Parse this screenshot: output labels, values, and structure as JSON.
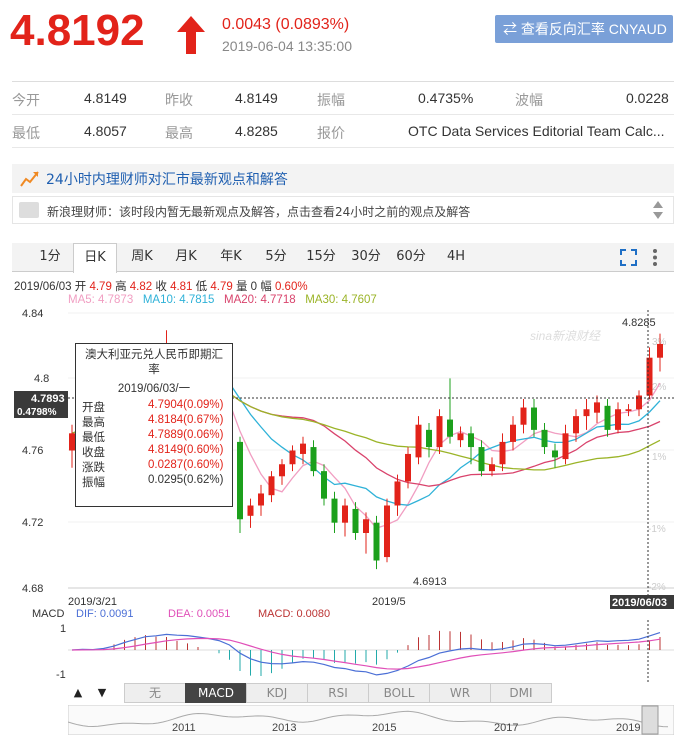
{
  "header": {
    "price": "4.8192",
    "change": "0.0043 (0.0893%)",
    "time": "2019-06-04 13:35:00",
    "reverse_button": "⇄ 查看反向汇率 CNYAUD"
  },
  "stats": {
    "row1": {
      "open_label": "今开",
      "open": "4.8149",
      "prev_close_label": "昨收",
      "prev_close": "4.8149",
      "amplitude_label": "振幅",
      "amplitude": "0.4735%",
      "wave_label": "波幅",
      "wave": "0.0228"
    },
    "row2": {
      "low_label": "最低",
      "low": "4.8057",
      "high_label": "最高",
      "high": "4.8285",
      "quote_label": "报价",
      "quote": "OTC Data Services Editorial Team Calc..."
    }
  },
  "advisor": {
    "title": "24小时内理财师对汇市最新观点和解答",
    "message": "新浪理财师：该时段内暂无最新观点及解答，点击查看24小时之前的观点及解答"
  },
  "tabs": [
    "1分",
    "日K",
    "周K",
    "月K",
    "年K",
    "5分",
    "15分",
    "30分",
    "60分",
    "4H"
  ],
  "active_tab": "日K",
  "legend": {
    "date": "2019/06/03",
    "open_label": "开",
    "open": "4.79",
    "high_label": "高",
    "high": "4.82",
    "close_label": "收",
    "close": "4.81",
    "low_label": "低",
    "low": "4.79",
    "volume_label": "量",
    "volume": "0",
    "amp_label": "幅",
    "amp": "0.60%"
  },
  "ma_legend": [
    {
      "text": "MA5: 4.7873",
      "color": "#f19ec2"
    },
    {
      "text": "MA10: 4.7815",
      "color": "#2fb2d8"
    },
    {
      "text": "MA20: 4.7718",
      "color": "#d9436c"
    },
    {
      "text": "MA30: 4.7607",
      "color": "#9bb428"
    }
  ],
  "tooltip": {
    "title": "澳大利亚元兑人民币即期汇率",
    "date": "2019/06/03/一",
    "rows": [
      {
        "label": "开盘",
        "value": "4.7904(0.09%)"
      },
      {
        "label": "最高",
        "value": "4.8184(0.67%)"
      },
      {
        "label": "最低",
        "value": "4.7889(0.06%)"
      },
      {
        "label": "收盘",
        "value": "4.8149(0.60%)"
      },
      {
        "label": "涨跌",
        "value": "0.0287(0.60%)"
      },
      {
        "label": "振幅",
        "value": "0.0295(0.62%)"
      }
    ]
  },
  "chart_axes": {
    "y_ticks": [
      "4.84",
      "4.8",
      "4.76",
      "4.72",
      "4.68"
    ],
    "pct_ticks": [
      "3%",
      "2%",
      "1%",
      "-1%",
      "-2%"
    ],
    "crosshair_price": "4.7893",
    "crosshair_pct": "0.4798%",
    "x_labels": [
      "2019/3/21",
      "2019/5"
    ],
    "x_cursor": "2019/06/03",
    "max_label": "4.8285",
    "min_label": "4.6913",
    "watermark": "sina新浪财经"
  },
  "macd": {
    "label": "MACD",
    "dif": "DIF: 0.0091",
    "dea": "DEA: 0.0051",
    "macd": "MACD: 0.0080",
    "ticks": [
      "1",
      "-1"
    ],
    "colors": {
      "dif": "#4b6fd6",
      "dea": "#e04fb8",
      "up": "#b33",
      "down": "#2aa"
    }
  },
  "indicators": [
    "无",
    "MACD",
    "KDJ",
    "RSI",
    "BOLL",
    "WR",
    "DMI"
  ],
  "active_indicator": "MACD",
  "timeline_years": [
    "2011",
    "2013",
    "2015",
    "2017",
    "2019"
  ],
  "chart_data": {
    "type": "candlestick",
    "ylim": [
      4.68,
      4.84
    ],
    "candles": [
      [
        4.76,
        4.77,
        4.75,
        4.775
      ],
      [
        4.77,
        4.775,
        4.765,
        4.785
      ],
      [
        4.775,
        4.77,
        4.765,
        4.782
      ],
      [
        4.77,
        4.78,
        4.768,
        4.79
      ],
      [
        4.78,
        4.795,
        4.775,
        4.8
      ],
      [
        4.795,
        4.81,
        4.79,
        4.815
      ],
      [
        4.805,
        4.812,
        4.8,
        4.818
      ],
      [
        4.812,
        4.818,
        4.808,
        4.822
      ],
      [
        4.815,
        4.808,
        4.805,
        4.82
      ],
      [
        4.808,
        4.815,
        4.802,
        4.83
      ],
      [
        4.812,
        4.8,
        4.795,
        4.816
      ],
      [
        4.8,
        4.803,
        4.795,
        4.808
      ],
      [
        4.802,
        4.795,
        4.79,
        4.806
      ],
      [
        4.795,
        4.793,
        4.788,
        4.798
      ],
      [
        4.792,
        4.786,
        4.78,
        4.796
      ],
      [
        4.787,
        4.762,
        4.755,
        4.788
      ],
      [
        4.765,
        4.72,
        4.712,
        4.768
      ],
      [
        4.722,
        4.728,
        4.715,
        4.732
      ],
      [
        4.728,
        4.735,
        4.722,
        4.74
      ],
      [
        4.734,
        4.745,
        4.73,
        4.748
      ],
      [
        4.745,
        4.752,
        4.74,
        4.755
      ],
      [
        4.752,
        4.76,
        4.748,
        4.763
      ],
      [
        4.758,
        4.764,
        4.752,
        4.768
      ],
      [
        4.762,
        4.748,
        4.745,
        4.766
      ],
      [
        4.748,
        4.732,
        4.728,
        4.752
      ],
      [
        4.732,
        4.718,
        4.712,
        4.736
      ],
      [
        4.718,
        4.728,
        4.71,
        4.732
      ],
      [
        4.726,
        4.712,
        4.708,
        4.73
      ],
      [
        4.712,
        4.72,
        4.7,
        4.724
      ],
      [
        4.718,
        4.696,
        4.691,
        4.722
      ],
      [
        4.698,
        4.728,
        4.695,
        4.732
      ],
      [
        4.728,
        4.742,
        4.722,
        4.746
      ],
      [
        4.742,
        4.758,
        4.738,
        4.762
      ],
      [
        4.756,
        4.775,
        4.752,
        4.78
      ],
      [
        4.772,
        4.762,
        4.756,
        4.776
      ],
      [
        4.762,
        4.78,
        4.758,
        4.784
      ],
      [
        4.778,
        4.768,
        4.764,
        4.802
      ],
      [
        4.766,
        4.77,
        4.762,
        4.774
      ],
      [
        4.77,
        4.762,
        4.752,
        4.774
      ],
      [
        4.762,
        4.748,
        4.745,
        4.766
      ],
      [
        4.748,
        4.752,
        4.745,
        4.756
      ],
      [
        4.752,
        4.765,
        4.748,
        4.77
      ],
      [
        4.765,
        4.775,
        4.76,
        4.78
      ],
      [
        4.775,
        4.785,
        4.77,
        4.79
      ],
      [
        4.785,
        4.772,
        4.768,
        4.79
      ],
      [
        4.772,
        4.762,
        4.758,
        4.776
      ],
      [
        4.76,
        4.756,
        4.75,
        4.764
      ],
      [
        4.755,
        4.77,
        4.752,
        4.775
      ],
      [
        4.77,
        4.78,
        4.765,
        4.784
      ],
      [
        4.78,
        4.784,
        4.772,
        4.79
      ],
      [
        4.782,
        4.788,
        4.776,
        4.792
      ],
      [
        4.786,
        4.772,
        4.768,
        4.79
      ],
      [
        4.772,
        4.784,
        4.77,
        4.788
      ],
      [
        4.783,
        4.784,
        4.78,
        4.787
      ],
      [
        4.784,
        4.792,
        4.78,
        4.795
      ],
      [
        4.792,
        4.814,
        4.79,
        4.82
      ],
      [
        4.814,
        4.822,
        4.806,
        4.828
      ]
    ]
  }
}
